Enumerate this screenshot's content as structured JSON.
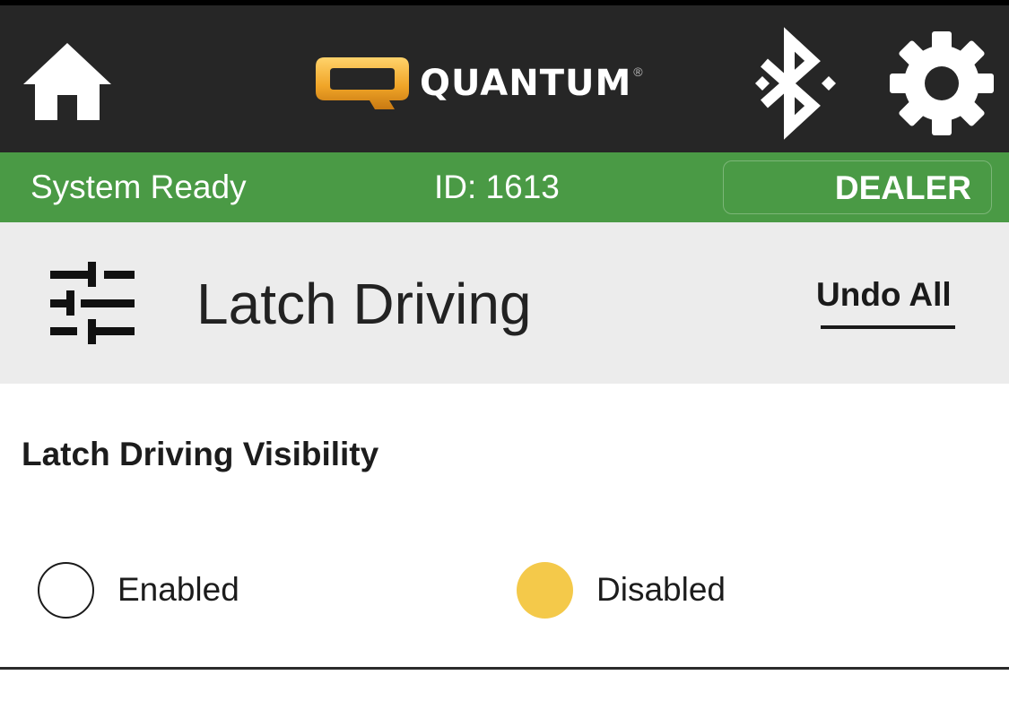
{
  "topbar": {
    "home_icon": "home-icon",
    "logo": {
      "brand": "QUANTUM",
      "registered": "®"
    },
    "bluetooth_icon": "bluetooth-icon",
    "settings_icon": "gear-icon"
  },
  "status_bar": {
    "status": "System Ready",
    "device_id": "ID: 1613",
    "mode_button": "DEALER",
    "color": "#4a9a45"
  },
  "header": {
    "icon": "sliders-icon",
    "title": "Latch Driving",
    "undo_label": "Undo All"
  },
  "section": {
    "title": "Latch Driving Visibility",
    "options": [
      {
        "label": "Enabled",
        "selected": false
      },
      {
        "label": "Disabled",
        "selected": true
      }
    ],
    "selected_color": "#f4c94a"
  }
}
